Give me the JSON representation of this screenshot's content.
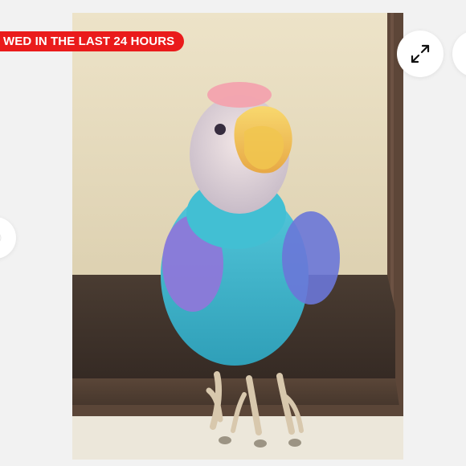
{
  "badge": {
    "text": "WED IN THE LAST 24 HOURS"
  },
  "buttons": {
    "expand_icon": "expand-icon",
    "next_icon": "partial-circle-button",
    "prev_icon": "partial-circle-button"
  },
  "colors": {
    "badge_bg": "#ea1b1b",
    "badge_text": "#ffffff",
    "background": "#f2f2f2",
    "button_bg": "#ffffff"
  }
}
